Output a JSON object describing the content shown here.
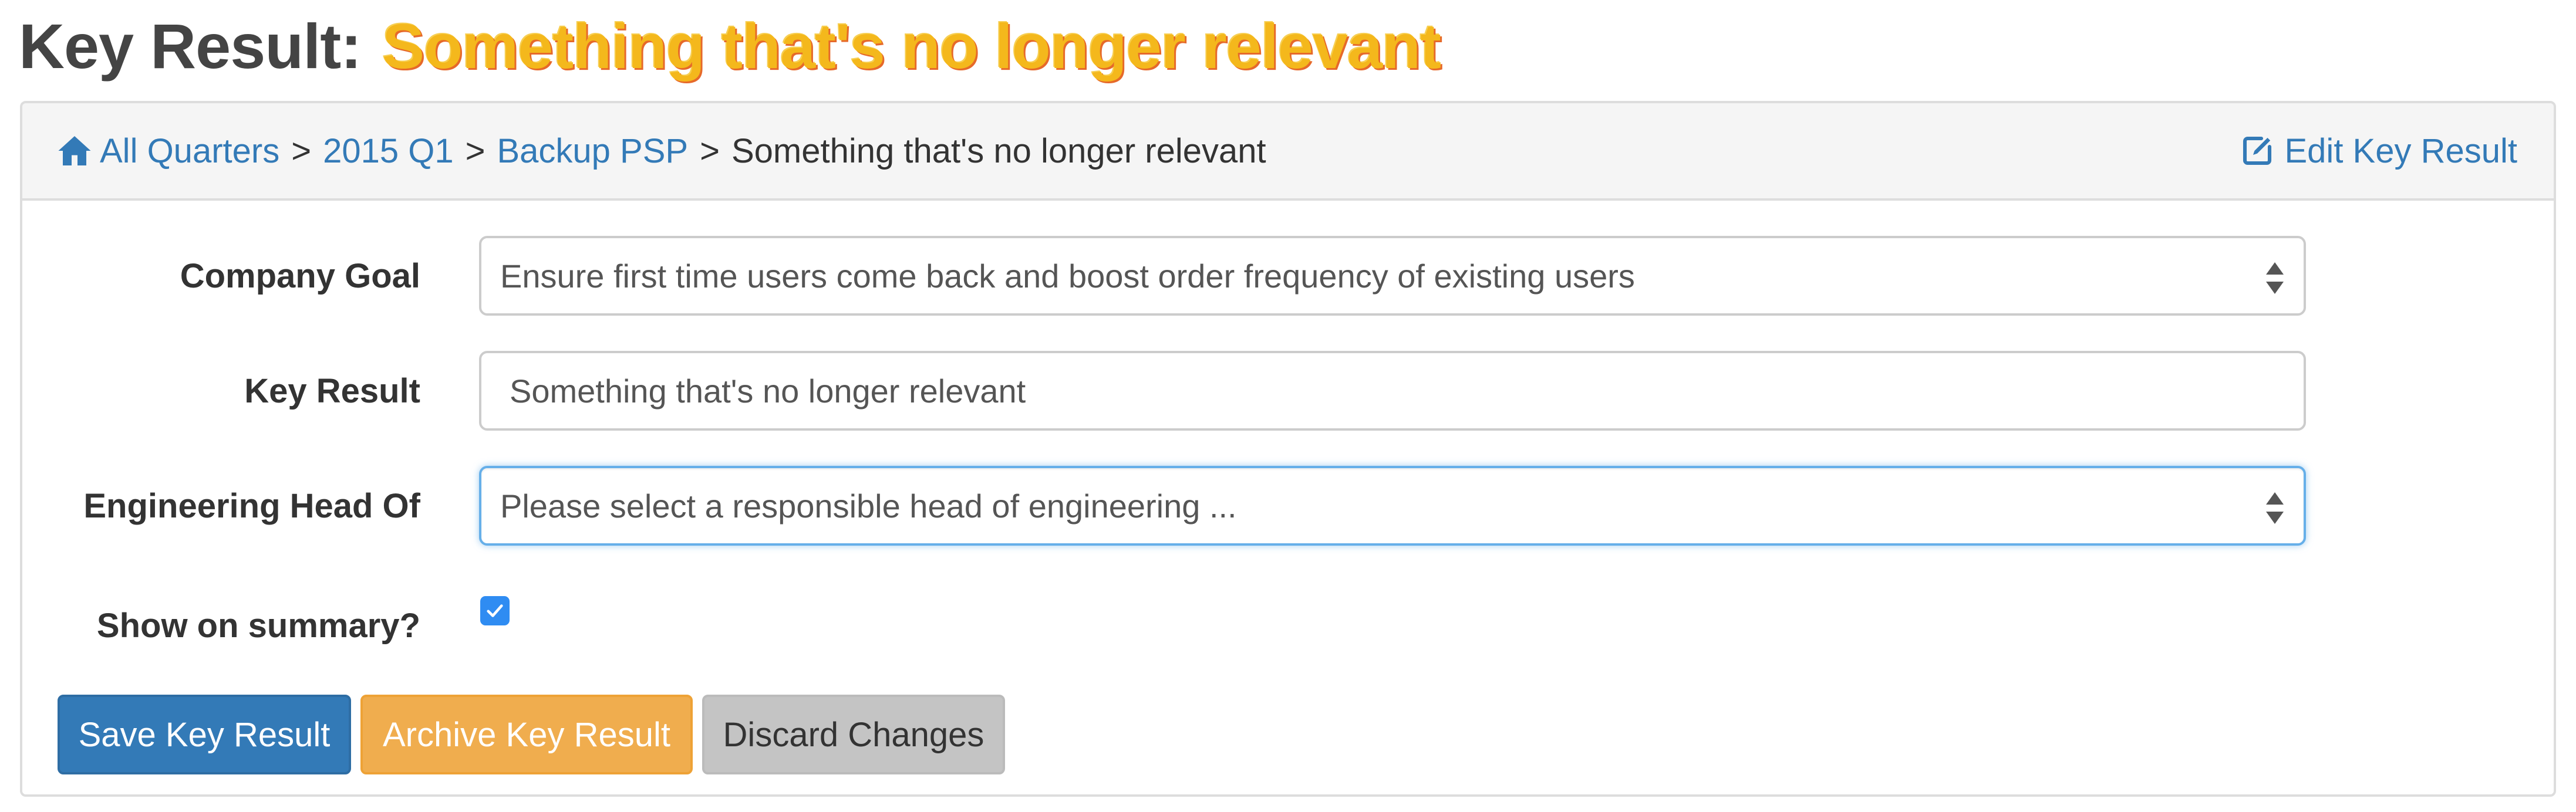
{
  "page": {
    "title_prefix": "Key Result:",
    "title_name": "Something that's no longer relevant"
  },
  "breadcrumb": {
    "items": [
      {
        "label": "All Quarters",
        "icon": "home-icon"
      },
      {
        "label": "2015 Q1"
      },
      {
        "label": "Backup PSP"
      }
    ],
    "separator": ">",
    "current": "Something that's no longer relevant"
  },
  "actions": {
    "edit_label": "Edit Key Result",
    "edit_icon": "edit-icon"
  },
  "form": {
    "company_goal": {
      "label": "Company Goal",
      "value": "Ensure first time users come back and boost order frequency of existing users"
    },
    "key_result": {
      "label": "Key Result",
      "value": "Something that's no longer relevant"
    },
    "engineering_head": {
      "label": "Engineering Head Of",
      "value": "Please select a responsible head of engineering ..."
    },
    "show_on_summary": {
      "label": "Show on summary?",
      "checked": true
    }
  },
  "buttons": {
    "save": "Save Key Result",
    "archive": "Archive Key Result",
    "discard": "Discard Changes"
  },
  "colors": {
    "link": "#337ab7",
    "primary": "#337ab7",
    "warning": "#f0ad4e",
    "title_highlight": "#f4b81c",
    "focus": "#66afe9"
  }
}
